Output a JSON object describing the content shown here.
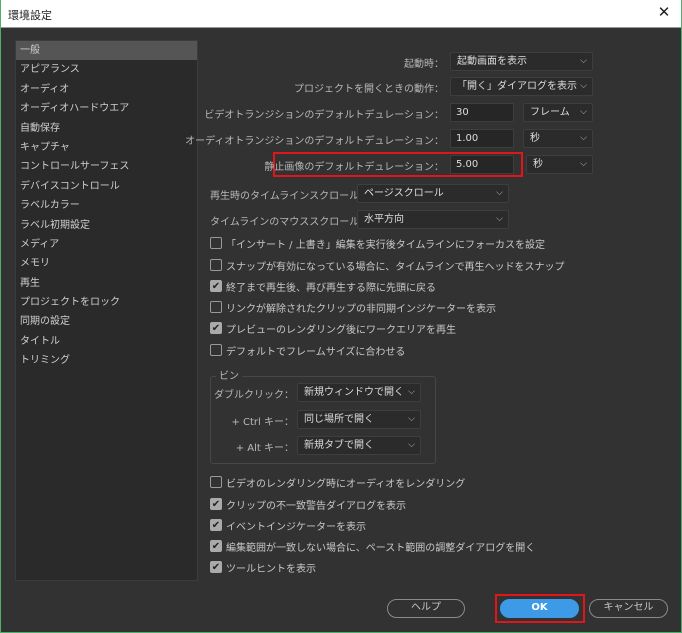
{
  "window": {
    "title": "環境設定",
    "close": "✕"
  },
  "sidebar": {
    "items": [
      "一般",
      "アピアランス",
      "オーディオ",
      "オーディオハードウエア",
      "自動保存",
      "キャプチャ",
      "コントロールサーフェス",
      "デバイスコントロール",
      "ラベルカラー",
      "ラベル初期設定",
      "メディア",
      "メモリ",
      "再生",
      "プロジェクトをロック",
      "同期の設定",
      "タイトル",
      "トリミング"
    ],
    "selected": "一般"
  },
  "general": {
    "startup": {
      "label": "起動時：",
      "value": "起動画面を表示"
    },
    "open_project": {
      "label": "プロジェクトを開くときの動作：",
      "value": "「開く」ダイアログを表示"
    },
    "video_transition": {
      "label": "ビデオトランジションのデフォルトデュレーション：",
      "value": "30",
      "unit": "フレーム"
    },
    "audio_transition": {
      "label": "オーディオトランジションのデフォルトデュレーション：",
      "value": "1.00",
      "unit": "秒"
    },
    "still_image": {
      "label": "静止画像のデフォルトデュレーション：",
      "value": "5.00",
      "unit": "秒"
    },
    "playback_scroll": {
      "label": "再生時のタイムラインスクロール：",
      "value": "ページスクロール"
    },
    "mouse_scroll": {
      "label": "タイムラインのマウススクロール：",
      "value": "水平方向"
    },
    "checkboxes1": [
      {
        "label": "「インサート / 上書き」編集を実行後タイムラインにフォーカスを設定",
        "checked": false
      },
      {
        "label": "スナップが有効になっている場合に、タイムラインで再生ヘッドをスナップ",
        "checked": false
      },
      {
        "label": "終了まで再生後、再び再生する際に先頭に戻る",
        "checked": true
      },
      {
        "label": "リンクが解除されたクリップの非同期インジケーターを表示",
        "checked": false
      },
      {
        "label": "プレビューのレンダリング後にワークエリアを再生",
        "checked": true
      },
      {
        "label": "デフォルトでフレームサイズに合わせる",
        "checked": false
      }
    ],
    "bin": {
      "title": "ビン",
      "double_click": {
        "label": "ダブルクリック：",
        "value": "新規ウィンドウで開く"
      },
      "ctrl": {
        "label": "+ Ctrl キー：",
        "value": "同じ場所で開く"
      },
      "alt": {
        "label": "+ Alt キー：",
        "value": "新規タブで開く"
      }
    },
    "checkboxes2": [
      {
        "label": "ビデオのレンダリング時にオーディオをレンダリング",
        "checked": false
      },
      {
        "label": "クリップの不一致警告ダイアログを表示",
        "checked": true
      },
      {
        "label": "イベントインジケーターを表示",
        "checked": true
      },
      {
        "label": "編集範囲が一致しない場合に、ペースト範囲の調整ダイアログを開く",
        "checked": true
      },
      {
        "label": "ツールヒントを表示",
        "checked": true
      }
    ]
  },
  "buttons": {
    "help": "ヘルプ",
    "ok": "OK",
    "cancel": "キャンセル"
  },
  "colors": {
    "accent": "#3c9ae6",
    "highlight": "#e0161b",
    "background": "#323232"
  }
}
